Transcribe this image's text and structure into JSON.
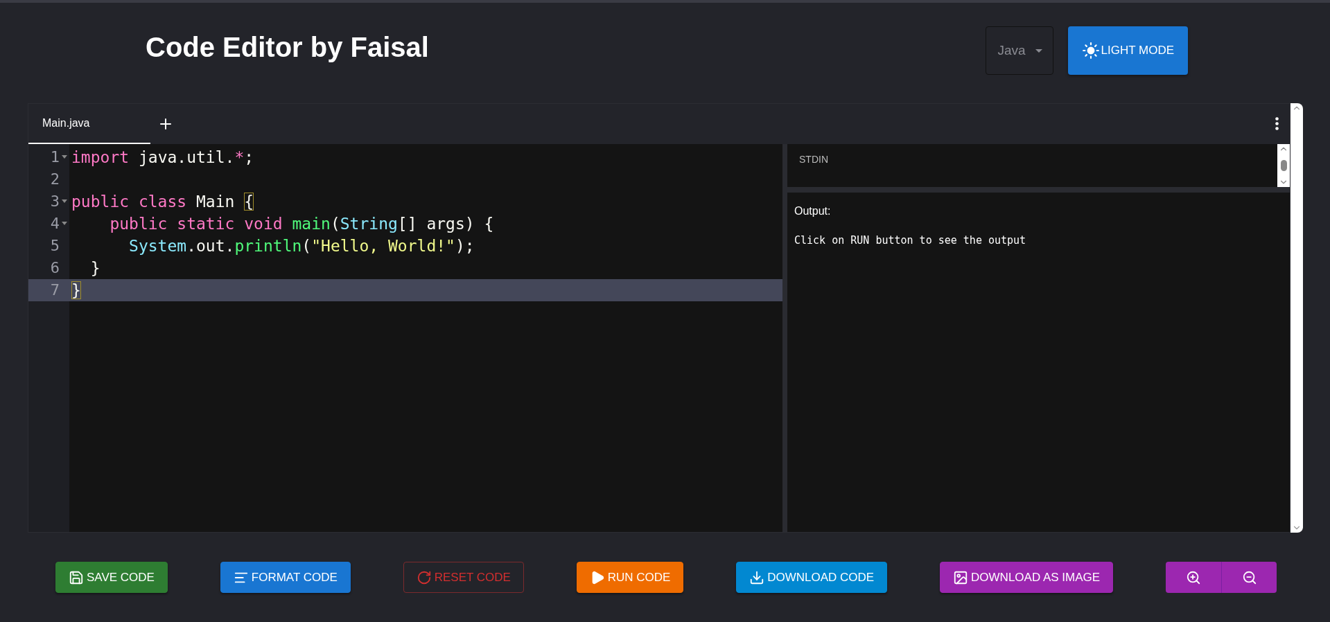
{
  "header": {
    "title": "Code Editor by Faisal",
    "language_select": {
      "value": "Java"
    },
    "theme_button": {
      "label": "LIGHT MODE"
    }
  },
  "editor": {
    "tabs": [
      {
        "label": "Main.java",
        "selected": true
      }
    ],
    "lines": [
      {
        "number": "1",
        "foldable": true,
        "active": false,
        "tokens": [
          {
            "kind": "keyword",
            "text": "import"
          },
          {
            "kind": "plain",
            "text": " java.util."
          },
          {
            "kind": "operator",
            "text": "*"
          },
          {
            "kind": "plain",
            "text": ";"
          }
        ]
      },
      {
        "number": "2",
        "foldable": false,
        "active": false
      },
      {
        "number": "3",
        "foldable": true,
        "active": false,
        "tokens": [
          {
            "kind": "keyword",
            "text": "public class"
          },
          {
            "kind": "plain",
            "text": " Main "
          },
          {
            "kind": "match",
            "text": "{"
          }
        ]
      },
      {
        "number": "4",
        "foldable": true,
        "active": false,
        "tokens": [
          {
            "kind": "keyword",
            "text": "    public static void"
          },
          {
            "kind": "function",
            "text": " main"
          },
          {
            "kind": "plain",
            "text": "("
          },
          {
            "kind": "type",
            "text": "String"
          },
          {
            "kind": "plain",
            "text": "[] args) {"
          }
        ]
      },
      {
        "number": "5",
        "foldable": false,
        "active": false,
        "tokens": [
          {
            "kind": "type",
            "text": "      System"
          },
          {
            "kind": "plain",
            "text": ".out."
          },
          {
            "kind": "function",
            "text": "println"
          },
          {
            "kind": "plain",
            "text": "("
          },
          {
            "kind": "string",
            "text": "\"Hello, World!\""
          },
          {
            "kind": "plain",
            "text": ");"
          }
        ]
      },
      {
        "number": "6",
        "foldable": false,
        "active": false,
        "tokens": [
          {
            "kind": "plain",
            "text": "  }"
          }
        ]
      },
      {
        "number": "7",
        "foldable": false,
        "active": true,
        "tokens": [
          {
            "kind": "match",
            "text": "}"
          }
        ]
      }
    ],
    "stdin": {
      "label": "STDIN"
    },
    "output": {
      "label": "Output:",
      "text": "Click on RUN button to see the output"
    }
  },
  "actions": [
    {
      "kind": "save",
      "label": "SAVE CODE",
      "color": "#2e7d32"
    },
    {
      "kind": "format",
      "label": "FORMAT CODE",
      "color": "#1976d2"
    },
    {
      "kind": "reset",
      "label": "RESET CODE",
      "color": "#d32f2f"
    },
    {
      "kind": "run",
      "label": "RUN CODE",
      "color": "#ef6c00"
    },
    {
      "kind": "download",
      "label": "DOWNLOAD CODE",
      "color": "#0288d1"
    },
    {
      "kind": "image",
      "label": "DOWNLOAD AS IMAGE",
      "color": "#9c27b0"
    }
  ],
  "zoom": [
    {
      "kind": "zoom-in"
    },
    {
      "kind": "zoom-out"
    }
  ]
}
